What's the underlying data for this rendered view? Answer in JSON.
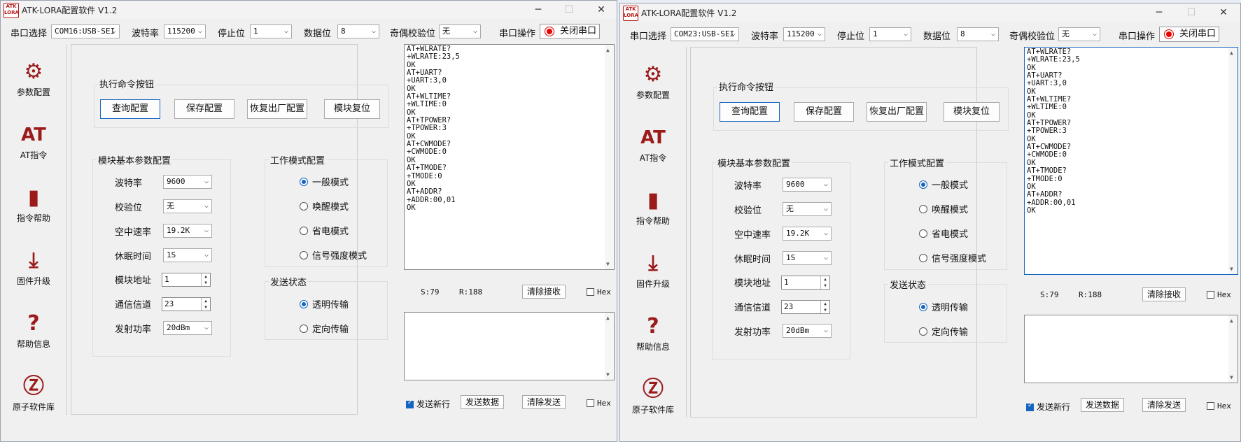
{
  "windows": [
    {
      "title": "ATK-LORA配置软件 V1.2",
      "toolbar": {
        "port_label": "串口选择",
        "port_value": "COM16:USB-SEI",
        "baud_label": "波特率",
        "baud_value": "115200",
        "stop_label": "停止位",
        "stop_value": "1",
        "data_label": "数据位",
        "data_value": "8",
        "parity_label": "奇偶校验位",
        "parity_value": "无",
        "op_label": "串口操作",
        "close_port": "关闭串口"
      },
      "nav": [
        "参数配置",
        "AT指令",
        "指令帮助",
        "固件升级",
        "帮助信息",
        "原子软件库"
      ],
      "cmd": {
        "title": "执行命令按钮",
        "query": "查询配置",
        "save": "保存配置",
        "restore": "恢复出厂配置",
        "reset": "模块复位"
      },
      "basic": {
        "title": "模块基本参数配置",
        "baud_label": "波特率",
        "baud_value": "9600",
        "check_label": "校验位",
        "check_value": "无",
        "air_label": "空中速率",
        "air_value": "19.2K",
        "sleep_label": "休眠时间",
        "sleep_value": "1S",
        "addr_label": "模块地址",
        "addr_value": "1",
        "chan_label": "通信信道",
        "chan_value": "23",
        "power_label": "发射功率",
        "power_value": "20dBm"
      },
      "mode": {
        "title": "工作模式配置",
        "options": [
          "一般模式",
          "唤醒模式",
          "省电模式",
          "信号强度模式"
        ]
      },
      "send_state": {
        "title": "发送状态",
        "options": [
          "透明传输",
          "定向传输"
        ]
      },
      "receive_text": "AT+WLRATE?\n+WLRATE:23,5\nOK\nAT+UART?\n+UART:3,0\nOK\nAT+WLTIME?\n+WLTIME:0\nOK\nAT+TPOWER?\n+TPOWER:3\nOK\nAT+CWMODE?\n+CWMODE:0\nOK\nAT+TMODE?\n+TMODE:0\nOK\nAT+ADDR?\n+ADDR:00,01\nOK",
      "stats": {
        "s": "S:79",
        "r": "R:188"
      },
      "clear_recv": "清除接收",
      "hex": "Hex",
      "newline": "发送新行",
      "send_data": "发送数据",
      "clear_send": "清除发送"
    },
    {
      "title": "ATK-LORA配置软件 V1.2",
      "toolbar": {
        "port_label": "串口选择",
        "port_value": "COM23:USB-SEI",
        "baud_label": "波特率",
        "baud_value": "115200",
        "stop_label": "停止位",
        "stop_value": "1",
        "data_label": "数据位",
        "data_value": "8",
        "parity_label": "奇偶校验位",
        "parity_value": "无",
        "op_label": "串口操作",
        "close_port": "关闭串口"
      },
      "nav": [
        "参数配置",
        "AT指令",
        "指令帮助",
        "固件升级",
        "帮助信息",
        "原子软件库"
      ],
      "cmd": {
        "title": "执行命令按钮",
        "query": "查询配置",
        "save": "保存配置",
        "restore": "恢复出厂配置",
        "reset": "模块复位"
      },
      "basic": {
        "title": "模块基本参数配置",
        "baud_label": "波特率",
        "baud_value": "9600",
        "check_label": "校验位",
        "check_value": "无",
        "air_label": "空中速率",
        "air_value": "19.2K",
        "sleep_label": "休眠时间",
        "sleep_value": "1S",
        "addr_label": "模块地址",
        "addr_value": "1",
        "chan_label": "通信信道",
        "chan_value": "23",
        "power_label": "发射功率",
        "power_value": "20dBm"
      },
      "mode": {
        "title": "工作模式配置",
        "options": [
          "一般模式",
          "唤醒模式",
          "省电模式",
          "信号强度模式"
        ]
      },
      "send_state": {
        "title": "发送状态",
        "options": [
          "透明传输",
          "定向传输"
        ]
      },
      "receive_text": "AT+WLRATE?\n+WLRATE:23,5\nOK\nAT+UART?\n+UART:3,0\nOK\nAT+WLTIME?\n+WLTIME:0\nOK\nAT+TPOWER?\n+TPOWER:3\nOK\nAT+CWMODE?\n+CWMODE:0\nOK\nAT+TMODE?\n+TMODE:0\nOK\nAT+ADDR?\n+ADDR:00,01\nOK",
      "stats": {
        "s": "S:79",
        "r": "R:188"
      },
      "clear_recv": "清除接收",
      "hex": "Hex",
      "newline": "发送新行",
      "send_data": "发送数据",
      "clear_send": "清除发送"
    }
  ]
}
